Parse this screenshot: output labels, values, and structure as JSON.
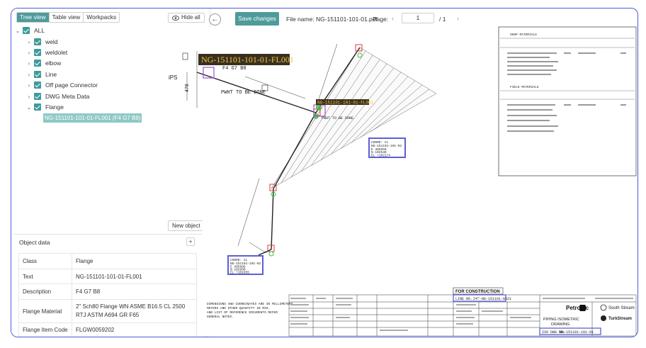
{
  "tabs": [
    "Tree view",
    "Table view",
    "Workpacks"
  ],
  "tree": {
    "root": "ALL",
    "items": [
      "weld",
      "weldolet",
      "elbow",
      "Line",
      "Off page Connector",
      "DWG Meta Data",
      "Flange"
    ],
    "selected_leaf": "NG-151101-101-01-FL001 (F4 G7 B8)"
  },
  "toolbar": {
    "hide_all": "Hide all",
    "save": "Save changes",
    "file_label": "File name: NG-151101-101-01.pdf",
    "page_label": "Page:",
    "page_value": "1",
    "page_total": "/  1",
    "new_object": "New object"
  },
  "object_data": {
    "title": "Object data",
    "rows": [
      {
        "key": "Class",
        "value": "Flange"
      },
      {
        "key": "Text",
        "value": "NG-151101-101-01-FL001"
      },
      {
        "key": "Description",
        "value": "F4 G7 B8"
      },
      {
        "key": "Flange Material",
        "value": "2\" Sch80 Flange WN ASME B16.5 CL 2500 RTJ ASTM A694 GR F65"
      },
      {
        "key": "Flange Item Code",
        "value": "FLGW0059202"
      }
    ]
  },
  "drawing": {
    "big_label": "NG-151101-101-01-FL001",
    "big_desc": "F4 G7 B8",
    "small_label": "NG-151101-101-01-FL001",
    "note": "PWHT TO BE DONE",
    "note2": "PWHT TO BE DONE",
    "ips": "iPS",
    "dim_478": "478",
    "box1": [
      "COORD: CL",
      "NG-151101-101-02",
      "E 485950",
      "N 102540",
      "EL +102174"
    ],
    "box2": [
      "COORD: CL",
      "NG-151101-101-02",
      "E 485986",
      "N 102600",
      "EL +101055"
    ],
    "for_construction": "FOR CONSTRUCTION",
    "line_no_label": "LINE NO.",
    "line_no": "24\"-NG-151101-G521",
    "iso_title1": "PIPING ISOMETRIC",
    "iso_title2": "DRAWING",
    "dwg_no_label": "ISO DWG NO.",
    "dwg_no": "NG-151101-101-01",
    "petrofac": "Petrofac",
    "south_stream": "South Stream",
    "turkstream": "TurkStream",
    "shop_materials": "SHOP MATERIALS",
    "field_materials": "FIELD MATERIALS",
    "notes": [
      "DIMENSIONS AND COORDINATES ARE IN MILLIMETERS.",
      "METERS AND OTHER QUANTITY IN M3S.",
      "AND LIST OF REFERENCE DOCUMENTS REFER",
      "GENERAL NOTES."
    ]
  }
}
